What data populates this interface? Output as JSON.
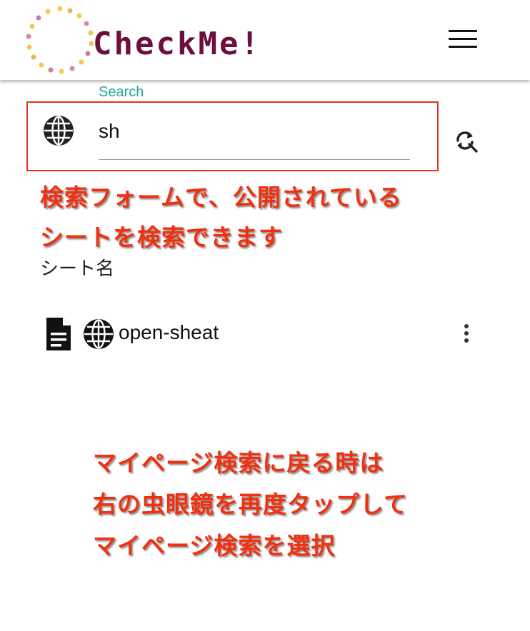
{
  "app": {
    "logo_text": "CheckMe!"
  },
  "header": {
    "menu_icon": "hamburger-menu-icon"
  },
  "search": {
    "label": "Search",
    "value": "sh",
    "scope_icon": "globe-icon",
    "refresh_icon": "search-refresh-icon",
    "highlight_color": "#e53222"
  },
  "annotations": {
    "search_note": [
      "検索フォームで、公開されている",
      "シートを検索できます"
    ],
    "return_note": [
      "マイページ検索に戻る時は",
      "右の虫眼鏡を再度タップして",
      "マイページ検索を選択"
    ],
    "color": "#f2300f"
  },
  "list": {
    "header": "シート名",
    "items": [
      {
        "name": "open-sheat",
        "type_icon": "document-icon",
        "visibility_icon": "globe-icon",
        "menu_icon": "more-vert-icon"
      }
    ]
  },
  "colors": {
    "label_teal": "#26a69a",
    "logo_maroon": "#6b0f3d"
  }
}
